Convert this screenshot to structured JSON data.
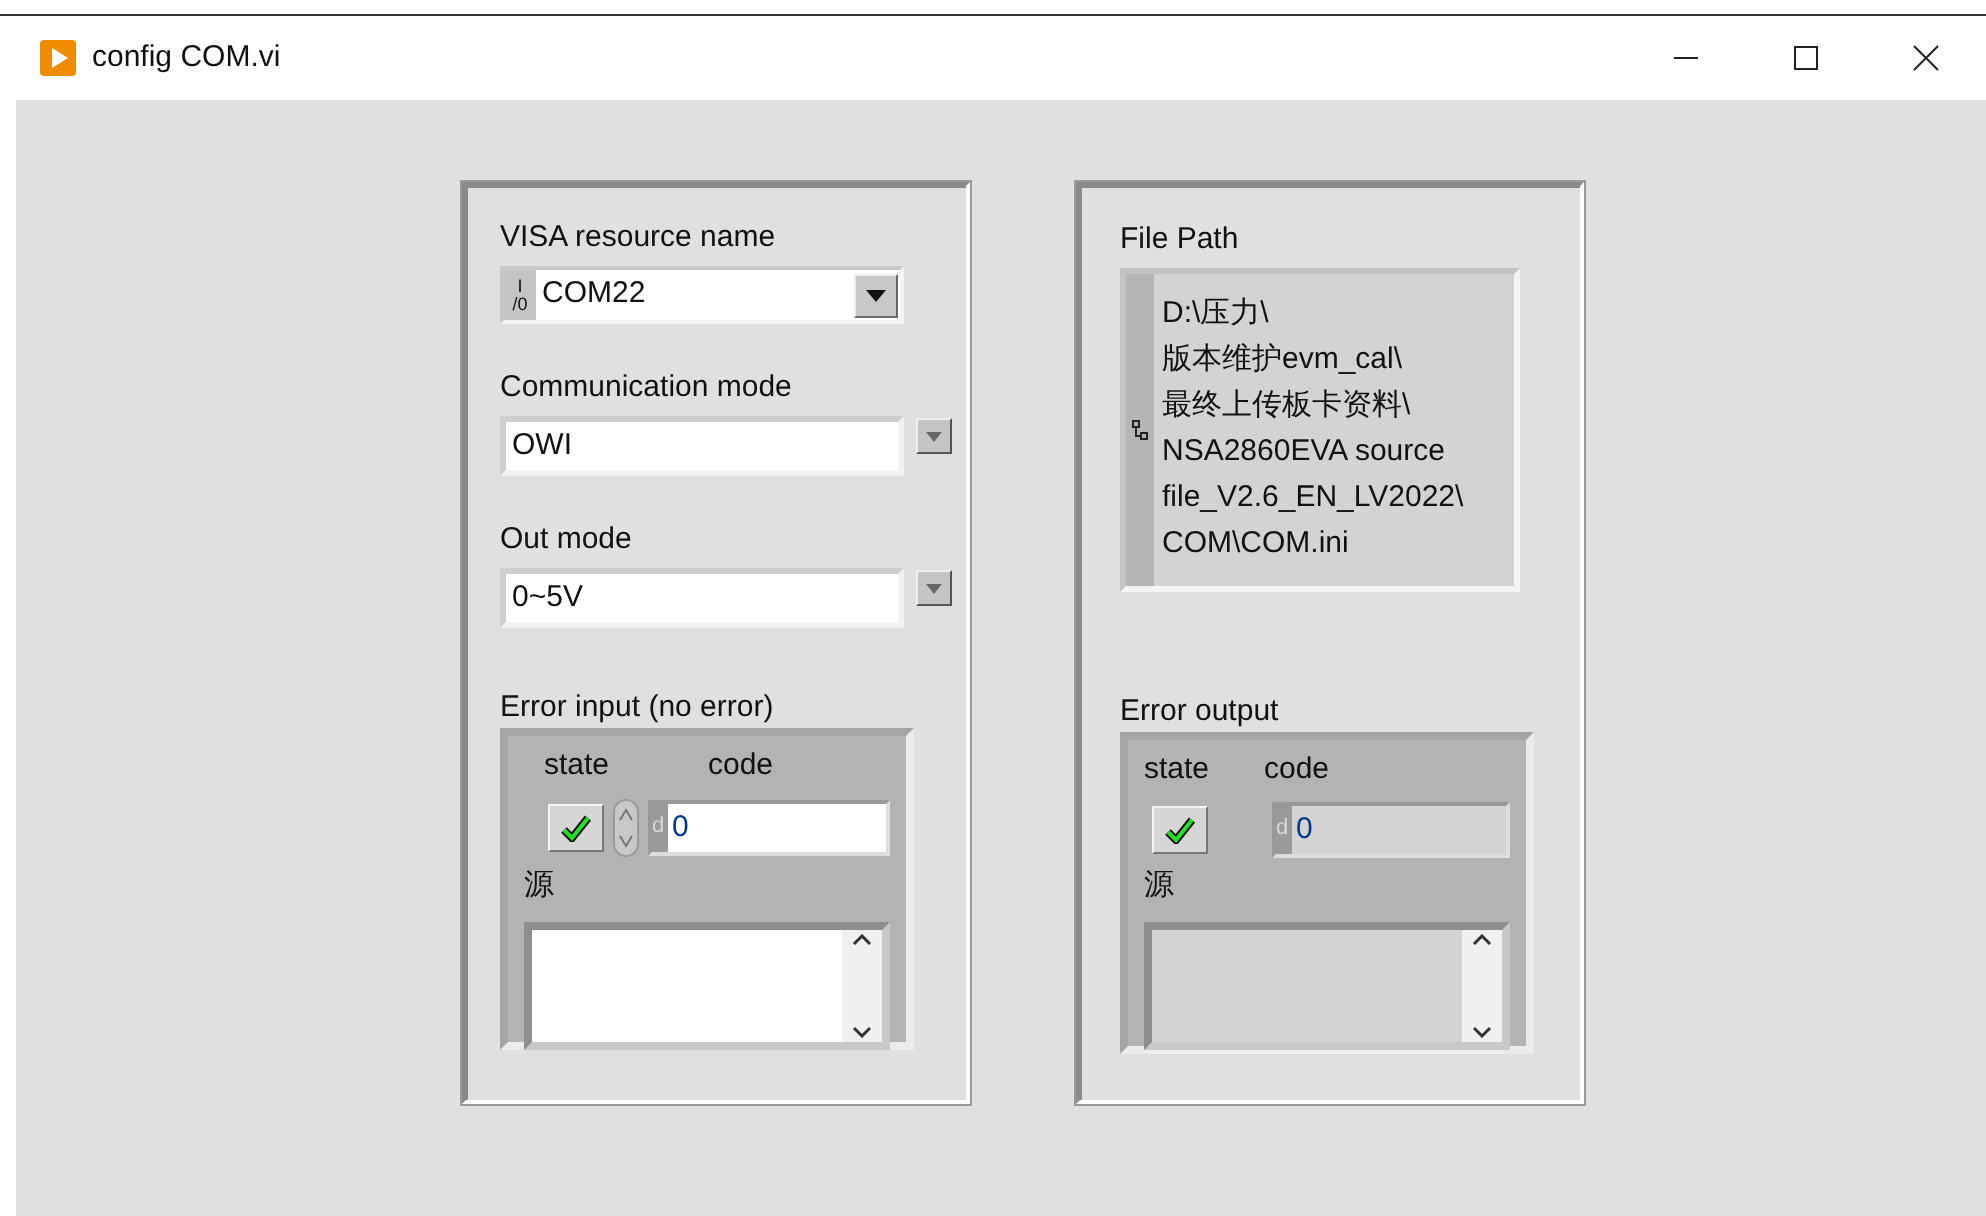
{
  "window": {
    "title": "config COM.vi"
  },
  "left_panel": {
    "visa": {
      "label": "VISA resource name",
      "prefix": "I/0",
      "value": "COM22"
    },
    "rings": [
      {
        "label": "Communication mode",
        "value": "OWI"
      },
      {
        "label": "Out mode",
        "value": "0~5V"
      }
    ],
    "error_cluster": {
      "kind": "control",
      "label": "Error input (no error)",
      "state_label": "state",
      "state_checked": true,
      "code_label": "code",
      "radix": "d",
      "code": "0",
      "source_label": "源"
    }
  },
  "right_panel": {
    "file_path": {
      "label": "File Path",
      "lines": [
        "D:\\压力\\",
        "版本维护evm_cal\\",
        "最终上传板卡资料\\",
        "NSA2860EVA source",
        "file_V2.6_EN_LV2022\\",
        "COM\\COM.ini"
      ]
    },
    "error_cluster": {
      "kind": "indicator",
      "label": "Error output",
      "state_label": "state",
      "state_checked": true,
      "code_label": "code",
      "radix": "d",
      "code": "0",
      "source_label": "源"
    }
  }
}
